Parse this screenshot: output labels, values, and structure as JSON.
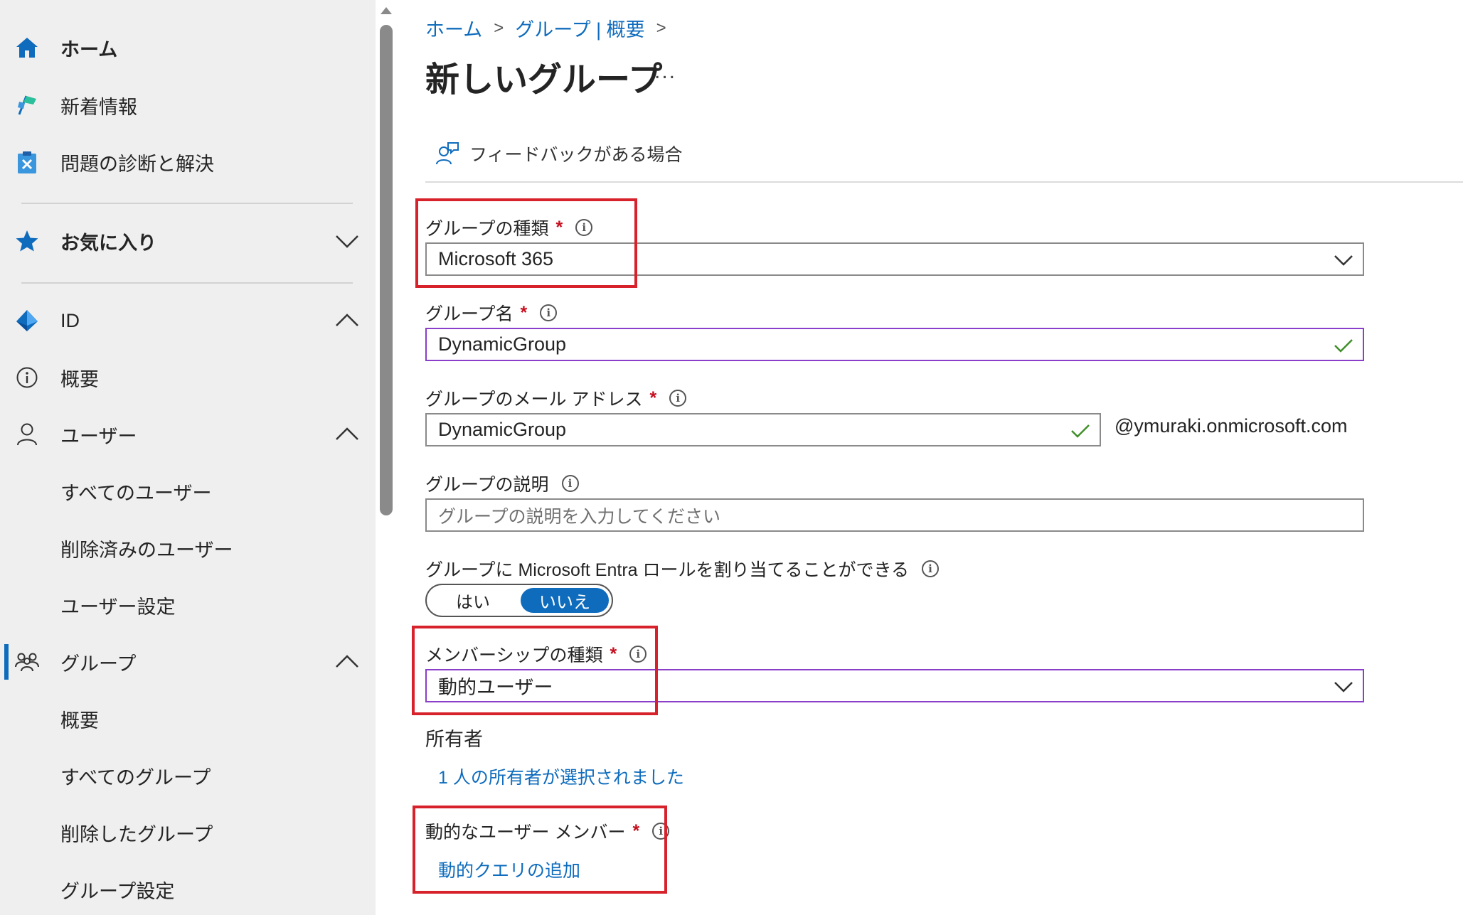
{
  "sidebar": {
    "home": "ホーム",
    "whats_new": "新着情報",
    "diagnose": "問題の診断と解決",
    "favorites": "お気に入り",
    "identity": "ID",
    "overview": "概要",
    "users": "ユーザー",
    "all_users": "すべてのユーザー",
    "deleted_users": "削除済みのユーザー",
    "user_settings": "ユーザー設定",
    "groups": "グループ",
    "groups_overview": "概要",
    "all_groups": "すべてのグループ",
    "deleted_groups": "削除したグループ",
    "group_settings": "グループ設定"
  },
  "breadcrumb": {
    "home": "ホーム",
    "groups": "グループ | 概要"
  },
  "page": {
    "title": "新しいグループ",
    "more": "...",
    "feedback": "フィードバックがある場合"
  },
  "form": {
    "group_type_label": "グループの種類",
    "group_type_value": "Microsoft 365",
    "group_name_label": "グループ名",
    "group_name_value": "DynamicGroup",
    "email_label": "グループのメール アドレス",
    "email_value": "DynamicGroup",
    "email_suffix": "@ymuraki.onmicrosoft.com",
    "description_label": "グループの説明",
    "description_placeholder": "グループの説明を入力してください",
    "entra_role_label": "グループに Microsoft Entra ロールを割り当てることができる",
    "toggle_yes": "はい",
    "toggle_no": "いいえ",
    "membership_label": "メンバーシップの種類",
    "membership_value": "動的ユーザー",
    "owner_label": "所有者",
    "owner_link": "1 人の所有者が選択されました",
    "dynamic_members_label": "動的なユーザー メンバー",
    "dynamic_query_link": "動的クエリの追加",
    "required_mark": "*",
    "info_glyph": "i"
  },
  "colors": {
    "accent": "#0f6cbd",
    "highlight": "#d7222c",
    "required": "#c50f1f",
    "valid_check": "#3f8f29"
  }
}
